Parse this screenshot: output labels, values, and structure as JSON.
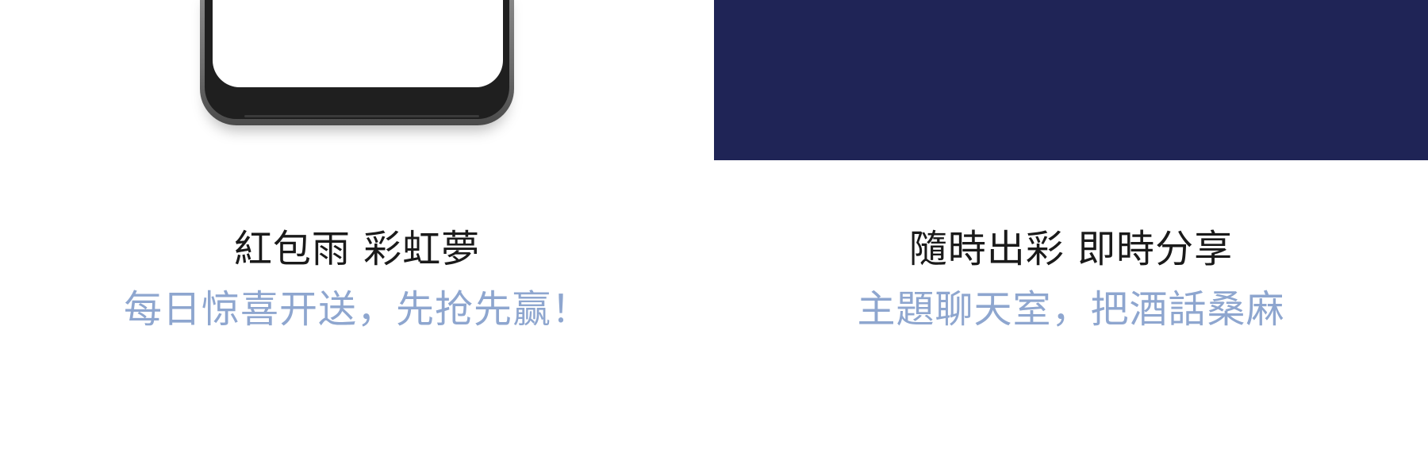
{
  "features": [
    {
      "title": "紅包雨 彩虹夢",
      "subtitle": "每日惊喜开送，先抢先赢！"
    },
    {
      "title": "隨時出彩 即時分享",
      "subtitle": "主題聊天室，把酒話桑麻"
    }
  ],
  "colors": {
    "navy_panel": "#1f2456",
    "title_text": "#1a1a1a",
    "subtitle_text": "#8ea6cf"
  }
}
